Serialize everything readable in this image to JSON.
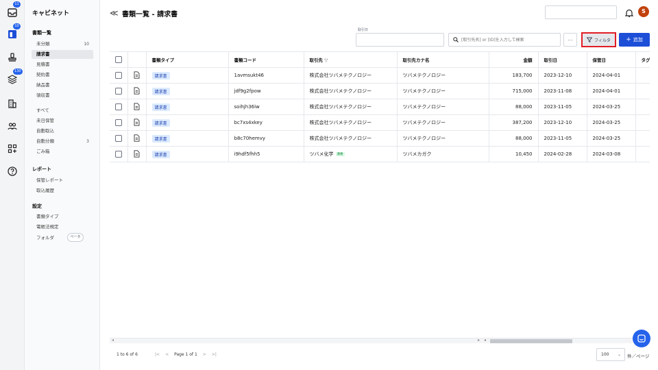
{
  "rail": {
    "badges": [
      "11",
      "10",
      "130"
    ]
  },
  "nav": {
    "brand": "キャビネット",
    "section_docs": "書類一覧",
    "items_docs": [
      {
        "label": "未分類",
        "count": "10"
      },
      {
        "label": "請求書",
        "count": ""
      },
      {
        "label": "見積書",
        "count": ""
      },
      {
        "label": "契約書",
        "count": ""
      },
      {
        "label": "納品書",
        "count": ""
      },
      {
        "label": "領収書",
        "count": ""
      }
    ],
    "items_other": [
      {
        "label": "すべて",
        "count": ""
      },
      {
        "label": "未日保管",
        "count": ""
      },
      {
        "label": "自動取込",
        "count": ""
      },
      {
        "label": "自動分類",
        "count": "3"
      },
      {
        "label": "ごみ箱",
        "count": ""
      }
    ],
    "section_report": "レポート",
    "items_report": [
      "保管レポート",
      "取込履歴"
    ],
    "section_settings": "設定",
    "items_settings": [
      "書類タイプ",
      "電帳法規定",
      "フォルダ"
    ],
    "beta_label": "ベータ"
  },
  "header": {
    "back_glyph": "≪",
    "title": "書類一覧 - 請求書",
    "avatar_initial": "S"
  },
  "toolbar": {
    "date_label": "取引日",
    "search_placeholder": "[取引先名] or [ID]を入力して検索",
    "more_label": "...",
    "filter_label": "フィルタ",
    "add_label": "追加"
  },
  "table": {
    "columns": [
      "書類タイプ",
      "書類コード",
      "取引先",
      "取引先カナ名",
      "金額",
      "取引日",
      "保管日",
      "タグ"
    ],
    "rows": [
      {
        "type": "請求書",
        "code": "1avmsukt46",
        "partner": "株式会社ツバメテクノロジー",
        "tax": "",
        "kana": "ツバメテクノロジー",
        "amount": "183,700",
        "date": "2023-12-10",
        "stored": "2024-04-01"
      },
      {
        "type": "請求書",
        "code": "jdf9g2fpow",
        "partner": "株式会社ツバメテクノロジー",
        "tax": "",
        "kana": "ツバメテクノロジー",
        "amount": "715,000",
        "date": "2023-11-08",
        "stored": "2024-04-01"
      },
      {
        "type": "請求書",
        "code": "soihjh36iw",
        "partner": "株式会社ツバメテクノロジー",
        "tax": "",
        "kana": "ツバメテクノロジー",
        "amount": "88,000",
        "date": "2023-11-05",
        "stored": "2024-03-25"
      },
      {
        "type": "請求書",
        "code": "bc7xs4xkey",
        "partner": "株式会社ツバメテクノロジー",
        "tax": "",
        "kana": "ツバメテクノロジー",
        "amount": "387,200",
        "date": "2023-12-10",
        "stored": "2024-03-25"
      },
      {
        "type": "請求書",
        "code": "b8c70hemvy",
        "partner": "株式会社ツバメテクノロジー",
        "tax": "",
        "kana": "ツバメテクノロジー",
        "amount": "88,000",
        "date": "2023-11-05",
        "stored": "2024-03-25"
      },
      {
        "type": "請求書",
        "code": "i9hdf5fhh5",
        "partner": "ツバメ化学",
        "tax": "適格",
        "kana": "ツバメカガク",
        "amount": "10,450",
        "date": "2024-02-28",
        "stored": "2024-03-08"
      }
    ]
  },
  "pager": {
    "info": "1 to 6 of 6",
    "page_text": "Page 1 of 1",
    "page_size": "100",
    "per_page_label": "件／ページ"
  },
  "colors": {
    "accent": "#1d4ed8",
    "highlight": "#e11d24",
    "avatar": "#c2410c"
  }
}
